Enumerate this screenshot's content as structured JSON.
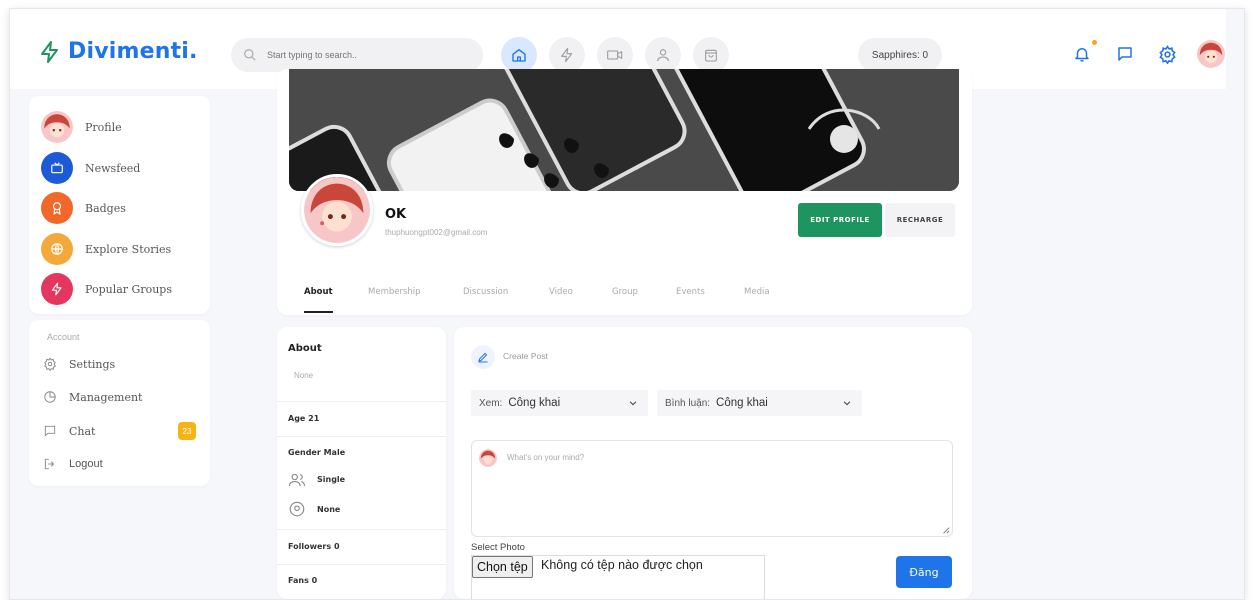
{
  "header": {
    "logo_text": "Divimenti.",
    "search_placeholder": "Start typing to search..",
    "nav_icons": [
      "home-icon",
      "bolt-icon",
      "video-icon",
      "user-icon",
      "shopping-bag-icon"
    ],
    "sapphires_label": "Sapphires: 0",
    "right_icons": [
      "bell-icon",
      "chat-bubble-icon",
      "gear-icon",
      "avatar"
    ]
  },
  "sidebar": {
    "items": [
      {
        "label": "Profile",
        "icon": "avatar"
      },
      {
        "label": "Newsfeed",
        "icon": "tv-icon",
        "color": "#1e5ad6"
      },
      {
        "label": "Badges",
        "icon": "badge-icon",
        "color": "#f2672a"
      },
      {
        "label": "Explore Stories",
        "icon": "globe-icon",
        "color": "#f5a83a"
      },
      {
        "label": "Popular Groups",
        "icon": "bolt-icon",
        "color": "#e5365f"
      }
    ],
    "account": {
      "title": "Account",
      "items": [
        {
          "label": "Settings",
          "icon": "gear-icon"
        },
        {
          "label": "Management",
          "icon": "pie-chart-icon"
        },
        {
          "label": "Chat",
          "icon": "chat-bubble-icon",
          "badge": "23"
        },
        {
          "label": "Logout",
          "icon": "logout-icon"
        }
      ]
    }
  },
  "profile": {
    "name": "OK",
    "email": "thuphuongpt002@gmail.com",
    "edit_label": "EDIT PROFILE",
    "recharge_label": "RECHARGE",
    "tabs": [
      "About",
      "Membership",
      "Discussion",
      "Video",
      "Group",
      "Events",
      "Media"
    ],
    "active_tab": "About",
    "accent_color": "#1e9460"
  },
  "about": {
    "title": "About",
    "description": "None",
    "age_label": "Age",
    "age_value": "21",
    "gender_label": "Gender",
    "gender_value": "Male",
    "relationship": "Single",
    "location": "None",
    "followers_label": "Followers",
    "followers_value": "0",
    "fans_label": "Fans",
    "fans_value": "0"
  },
  "post": {
    "create_label": "Create Post",
    "view_label": "Xem:",
    "view_value": "Công khai",
    "comment_label": "Bình luận:",
    "comment_value": "Công khai",
    "placeholder": "What's on your mind?",
    "select_photo_label": "Select Photo",
    "file_button": "Chọn tệp",
    "file_status": "Không có tệp nào được chọn",
    "submit_label": "Đăng",
    "submit_color": "#1e74e8"
  }
}
